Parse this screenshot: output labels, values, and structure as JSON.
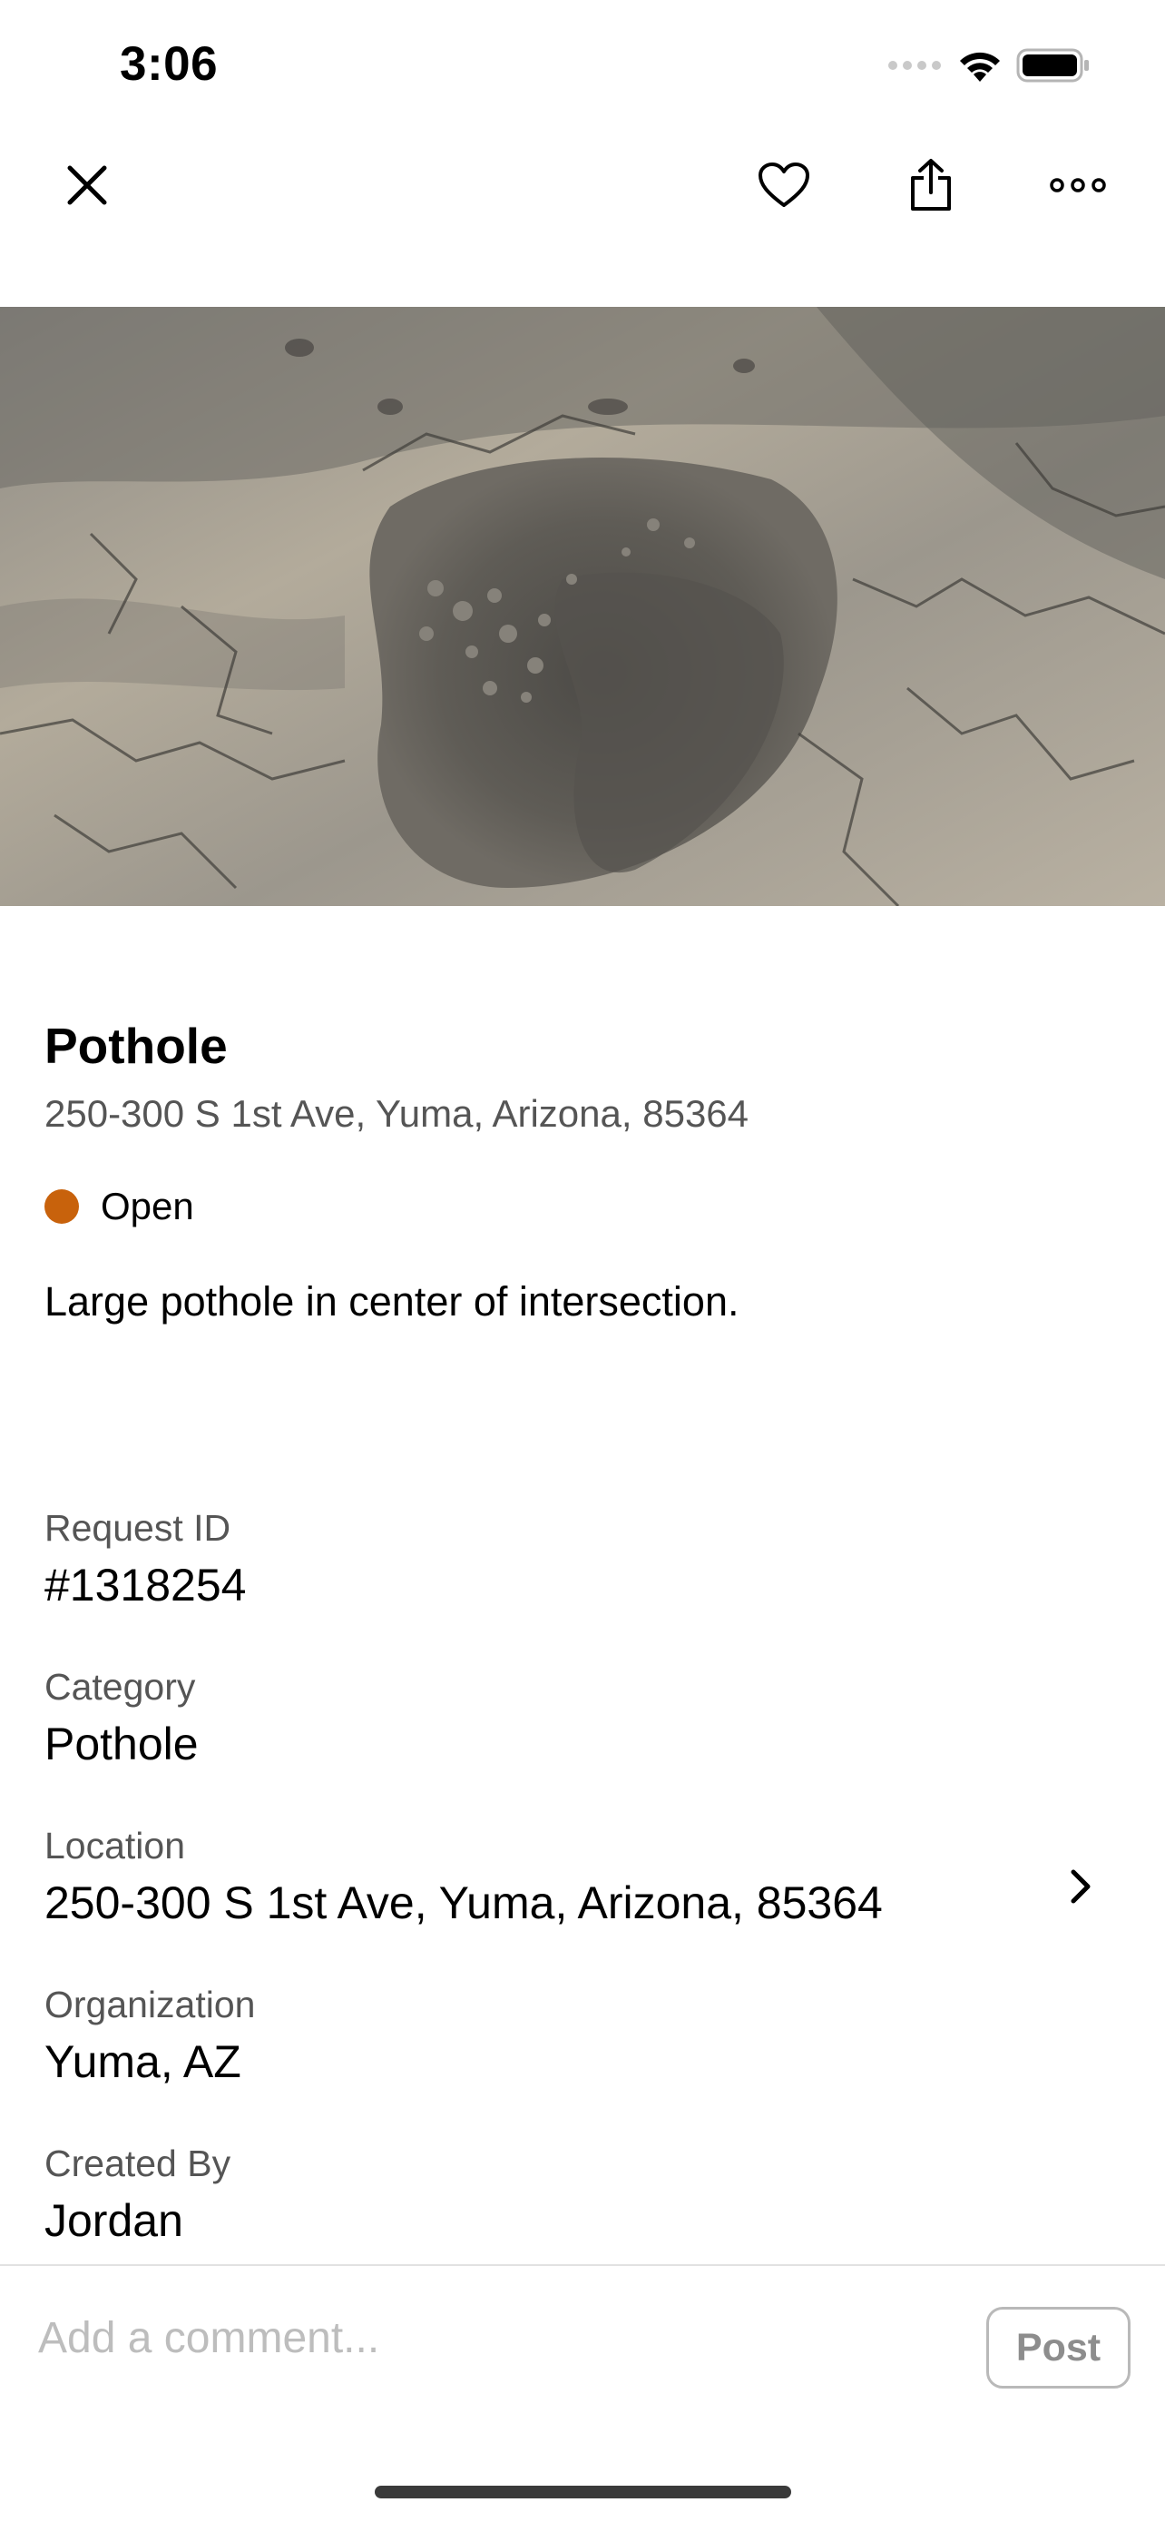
{
  "status_bar": {
    "time": "3:06",
    "icons": [
      "signal-icon",
      "wifi-icon",
      "battery-icon"
    ]
  },
  "nav": {
    "icons": [
      "close-icon",
      "heart-icon",
      "share-icon",
      "more-icon"
    ]
  },
  "request": {
    "title": "Pothole",
    "address": "250-300 S 1st Ave, Yuma, Arizona, 85364",
    "status": "Open",
    "status_color": "#c8620c",
    "description": "Large pothole in center of intersection."
  },
  "details": [
    {
      "label": "Request ID",
      "value": "#1318254"
    },
    {
      "label": "Category",
      "value": "Pothole"
    },
    {
      "label": "Location",
      "value": "250-300 S 1st Ave, Yuma, Arizona, 85364"
    },
    {
      "label": "Organization",
      "value": "Yuma, AZ"
    },
    {
      "label": "Created By",
      "value": "Jordan"
    }
  ],
  "comment": {
    "placeholder": "Add a comment...",
    "post_label": "Post"
  }
}
